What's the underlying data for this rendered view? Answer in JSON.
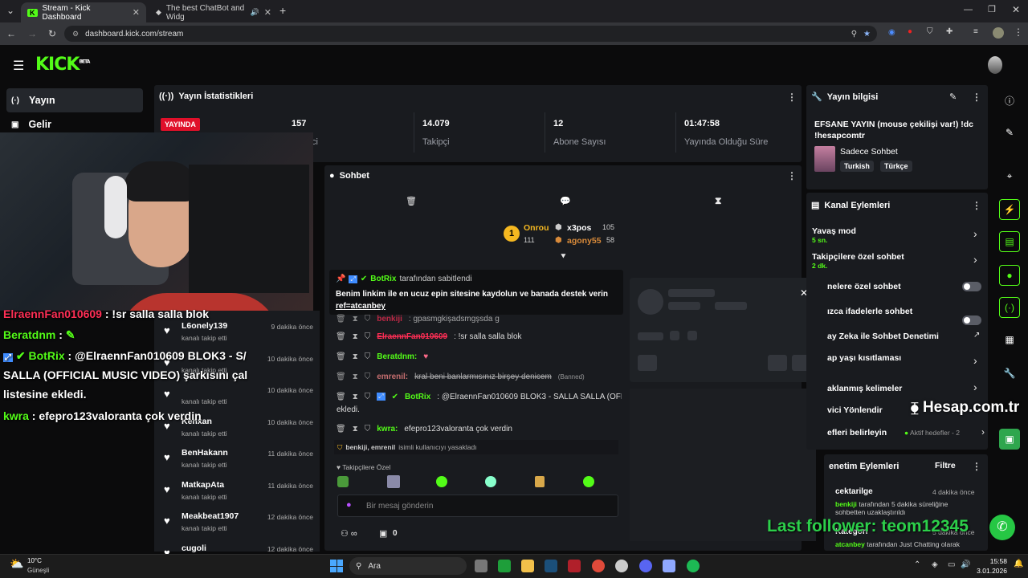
{
  "browser": {
    "tabs": [
      {
        "title": "Stream - Kick Dashboard",
        "active": true
      },
      {
        "title": "The best ChatBot and Widg",
        "active": false
      }
    ],
    "url": "dashboard.kick.com/stream"
  },
  "kick": {
    "logo": "KICK",
    "logo_badge": "BETA"
  },
  "sidebar": {
    "items": [
      {
        "label": "Yayın",
        "icon": "broadcast-icon"
      },
      {
        "label": "Gelir",
        "icon": "revenue-icon"
      }
    ]
  },
  "stats": {
    "title": "Yayın İstatistikleri",
    "live_badge": "YAYINDA",
    "items": [
      {
        "value": "157",
        "label": "ci"
      },
      {
        "value": "14.079",
        "label": "Takipçi"
      },
      {
        "value": "12",
        "label": "Abone Sayısı"
      },
      {
        "value": "01:47:58",
        "label": "Yayında Olduğu Süre"
      }
    ]
  },
  "stream_info": {
    "title": "Yayın bilgisi",
    "stream_title": "EFSANE YAYIN (mouse çekilişi var!) !dc !hesapcomtr",
    "category": "Sadece Sohbet",
    "tags": [
      "Turkish",
      "Türkçe"
    ]
  },
  "overlay": {
    "chat_lines": [
      {
        "user": "ElraennFan010609",
        "text": " : !sr salla salla blok",
        "color": "#ff2e55"
      },
      {
        "user": "Beratdnm",
        "text": " :",
        "color": "#53fc18"
      },
      {
        "user": "BotRix",
        "text": " : @ElraennFan010609 BLOK3 - S/",
        "color": "#53fc18"
      },
      {
        "user": "",
        "text": "SALLA (OFFICIAL MUSIC VIDEO) şarkısını çal",
        "color": "#fff"
      },
      {
        "user": "",
        "text": "listesine ekledi.",
        "color": "#fff"
      },
      {
        "user": "kwra",
        "text": " : efepro123valoranta çok verdin",
        "color": "#53fc18"
      }
    ],
    "last_follower": "Last follower: teom12345",
    "watermark": "Hesap.com.tr"
  },
  "followers": [
    {
      "name": "L6onely139",
      "sub": "kanalı takip etti",
      "time": "9 dakika önce"
    },
    {
      "name": "",
      "sub": "kanalı takip etti",
      "time": "10 dakika önce"
    },
    {
      "name": "",
      "sub": "kanalı takip etti",
      "time": "10 dakika önce"
    },
    {
      "name": "Kehxan",
      "sub": "kanalı takip etti",
      "time": "10 dakika önce"
    },
    {
      "name": "BenHakann",
      "sub": "kanalı takip etti",
      "time": "11 dakika önce"
    },
    {
      "name": "MatkapAta",
      "sub": "kanalı takip etti",
      "time": "11 dakika önce"
    },
    {
      "name": "Meakbeat1907",
      "sub": "kanalı takip etti",
      "time": "12 dakika önce"
    },
    {
      "name": "cugoli",
      "sub": "kanalı takip etti",
      "time": "12 dakika önce"
    }
  ],
  "chat": {
    "title": "Sohbet",
    "leaderboard": [
      {
        "name": "Onrou",
        "value": "111"
      },
      {
        "name": "x3pos",
        "value": "105"
      },
      {
        "name": "agony55",
        "value": "58"
      }
    ],
    "pinned_by": "BotRix",
    "pinned_suffix": "tarafından sabitlendi",
    "pinned_text": "Benim linkim ile en ucuz epin sitesine kaydolun ve banada destek verin",
    "pinned_link": "ref=atcanbey",
    "messages": [
      {
        "user": "benkiji",
        "text": ": gpasmgkişadsmgşsda g",
        "color": "#ff2e55"
      },
      {
        "user": "ElraennFan010609",
        "text": ": !sr salla salla blok",
        "color": "#ff2e55"
      },
      {
        "user": "Beratdnm:",
        "text": "",
        "color": "#53fc18"
      },
      {
        "user": "emrenil:",
        "text": "kral beni banlarmısınız birşey denicem",
        "color": "#ff8a8a",
        "deleted": true,
        "tag": "(Banned)"
      },
      {
        "user": "BotRix",
        "text": ": @ElraennFan010609 BLOK3 - SALLA SALLA (OFFIC",
        "color": "#53fc18"
      },
      {
        "user": "",
        "text": "ekledi.",
        "color": "#fff"
      },
      {
        "user": "kwra:",
        "text": "efepro123valoranta çok verdin",
        "color": "#53fc18"
      }
    ],
    "ban_notice_users": "benkiji, emrenil",
    "ban_notice_text": "isimli kullanıcıyı yasakladı",
    "followers_only": "Takipçilere Özel",
    "input_placeholder": "Bir mesaj gönderin",
    "footer_count": "0"
  },
  "channel_actions": {
    "title": "Kanal Eylemleri",
    "items": [
      {
        "label": "Yavaş mod",
        "sub": "5 sn."
      },
      {
        "label": "Takipçilere özel sohbet",
        "sub": "2 dk."
      },
      {
        "label": "nelere özel sohbet",
        "sub": ""
      },
      {
        "label": "ızca ifadelerle sohbet",
        "sub": ""
      },
      {
        "label": "ay Zeka ile Sohbet Denetimi",
        "sub": ""
      },
      {
        "label": "ap yaşı kısıtlaması",
        "sub": ""
      },
      {
        "label": "aklanmış kelimeler",
        "sub": ""
      },
      {
        "label": "vici Yönlendir",
        "sub": ""
      },
      {
        "label": "efleri belirleyin",
        "sub": "Aktif hedefler - 2"
      }
    ]
  },
  "mod_actions": {
    "title": "enetim Eylemleri",
    "filter": "Filtre",
    "items": [
      {
        "title": "cektarilge",
        "time": "4 dakika önce",
        "user": "benkiji",
        "text": "tarafından 5 dakika süreliğine sohbetten uzaklaştırıldı"
      },
      {
        "title": "Kategori",
        "time": "5 dakika önce",
        "user": "atcanbey",
        "text": "tarafından Just Chatting olarak"
      }
    ]
  },
  "taskbar": {
    "weather_temp": "10°C",
    "weather_desc": "Güneşli",
    "search": "Ara",
    "time": "15:58",
    "date": "3.01.2026"
  }
}
